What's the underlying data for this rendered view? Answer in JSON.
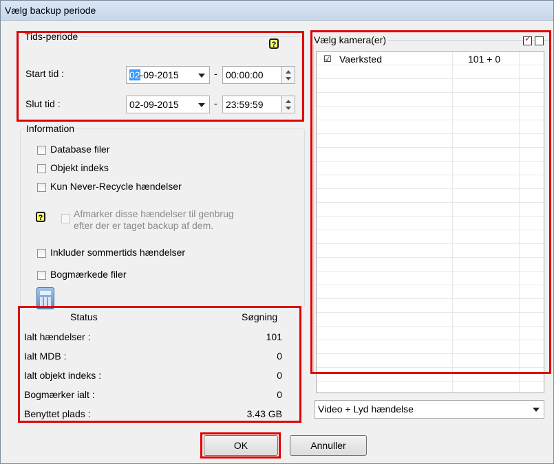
{
  "window": {
    "title": "Vælg backup periode"
  },
  "period": {
    "legend": "Tids-periode",
    "start_label": "Start tid :",
    "start_date_sel": "02",
    "start_date_rest": "-09-2015",
    "start_time": "00:00:00",
    "end_label": "Slut tid :",
    "end_date": "02-09-2015",
    "end_time": "23:59:59",
    "dash": "-"
  },
  "info": {
    "legend": "Information",
    "options": [
      {
        "label": "Database filer",
        "checked": false
      },
      {
        "label": "Objekt indeks",
        "checked": false
      },
      {
        "label": "Kun Never-Recycle hændelser",
        "checked": false
      }
    ],
    "recycle_line1": "Afmarker disse hændelser til genbrug",
    "recycle_line2": "efter der er taget backup af dem.",
    "dst_label": "Inkluder sommertids hændelser",
    "bookmarks_label": "Bogmærkede filer"
  },
  "status": {
    "header_status": "Status",
    "header_search": "Søgning",
    "rows": [
      {
        "label": "Ialt hændelser :",
        "value": "101"
      },
      {
        "label": "Ialt MDB :",
        "value": "0"
      },
      {
        "label": "Ialt objekt indeks :",
        "value": "0"
      },
      {
        "label": "Bogmærker ialt :",
        "value": "0"
      },
      {
        "label": "Benyttet plads :",
        "value": "3.43 GB"
      }
    ]
  },
  "cameras": {
    "legend": "Vælg kamera(er)",
    "items": [
      {
        "name": "Vaerksted",
        "count": "101 + 0",
        "checked": true
      }
    ]
  },
  "event_type": {
    "selected": "Video + Lyd hændelse"
  },
  "buttons": {
    "ok": "OK",
    "cancel": "Annuller"
  },
  "colors": {
    "highlight": "#e00000",
    "selection": "#3399ff"
  }
}
